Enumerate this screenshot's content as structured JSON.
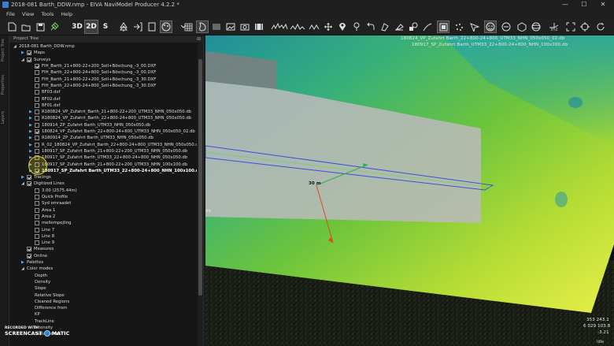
{
  "window": {
    "title": "2018-081 Barth_DDW.nmp - EIVA NaviModel Producer 4.2.2 *",
    "minimize": "—",
    "maximize": "☐",
    "close": "✕"
  },
  "menu": [
    "File",
    "View",
    "Tools",
    "Help"
  ],
  "toolbar": {
    "btn_3d": "3D",
    "btn_2d": "2D",
    "btn_s": "S",
    "xyz": "XYZ"
  },
  "sidetabs": [
    "Project Tree",
    "Properties",
    "Layers"
  ],
  "panel": {
    "title": "Project Tree",
    "pin": "⊞"
  },
  "tree": [
    {
      "label": "2018-081 Barth_DDW.nmp",
      "indent": 0,
      "expander": "open",
      "check": "none"
    },
    {
      "label": "Maps",
      "indent": 1,
      "expander": "closed",
      "check": "on"
    },
    {
      "label": "Surveys",
      "indent": 1,
      "expander": "open",
      "check": "on"
    },
    {
      "label": "FIH_Barth_21+800-22+200_Soll+Böschung_-3_00.DXF",
      "indent": 2,
      "expander": "none",
      "check": "on"
    },
    {
      "label": "FIH_Barth_22+800-24+800_Soll+Böschung_-3_00.DXF",
      "indent": 2,
      "expander": "none",
      "check": "off"
    },
    {
      "label": "FIH_Barth_21+800-22+200_Soll+Böschung_-3_30.DXF",
      "indent": 2,
      "expander": "none",
      "check": "off"
    },
    {
      "label": "FIH_Barth_22+800-24+800_Soll+Böschung_-3_30.DXF",
      "indent": 2,
      "expander": "none",
      "check": "off"
    },
    {
      "label": "BF03.dxf",
      "indent": 2,
      "expander": "none",
      "check": "off"
    },
    {
      "label": "BF02.dxf",
      "indent": 2,
      "expander": "none",
      "check": "off"
    },
    {
      "label": "BF01.dxf",
      "indent": 2,
      "expander": "none",
      "check": "off"
    },
    {
      "label": "R180824_VP_Zufahrt_Barth_21+800-22+200_UTM33_NHN_050x050.db",
      "indent": 2,
      "expander": "closed",
      "check": "off"
    },
    {
      "label": "R180824_VP_Zufahrt_Barth_22+800-24+800_UTM33_NHN_050x050.db",
      "indent": 2,
      "expander": "closed",
      "check": "off"
    },
    {
      "label": "180914_ZP_Zufahrt Barth_UTM33_NHN_050x050.db",
      "indent": 2,
      "expander": "closed",
      "check": "off"
    },
    {
      "label": "180824_VP_Zufahrt Barth_22+800-24+800_UTM33_NHN_050x050_02.db",
      "indent": 2,
      "expander": "closed",
      "check": "on"
    },
    {
      "label": "R180914_ZP_Zufahrt Barth_UTM33_NHN_050x050.db",
      "indent": 2,
      "expander": "closed",
      "check": "off"
    },
    {
      "label": "R_02_180824_VP_Zufahrt_Barth_22+800-24+800_UTM33_NHN_050x050.dt",
      "indent": 2,
      "expander": "closed",
      "check": "off"
    },
    {
      "label": "180917_SP_Zufahrt Barth_21+800-22+200_UTM33_NHN_050x050.db",
      "indent": 2,
      "expander": "closed",
      "check": "off"
    },
    {
      "label": "180917_SP_Zufahrt Barth_UTM33_22+800-24+800_NHN_050x050.db",
      "indent": 2,
      "expander": "closed",
      "check": "off"
    },
    {
      "label": "180917_SP_Zufahrt Barth_21+800-22+200_UTM33_NHN_100x100.db",
      "indent": 2,
      "expander": "closed",
      "check": "off"
    },
    {
      "label": "180917_SP_Zufahrt Barth_UTM33_22+800-24+800_NHN_100x100.db",
      "indent": 2,
      "expander": "closed",
      "check": "on",
      "bold": true
    },
    {
      "label": "Tracings",
      "indent": 1,
      "expander": "closed",
      "check": "on"
    },
    {
      "label": "Digitized Lines",
      "indent": 1,
      "expander": "open",
      "check": "on"
    },
    {
      "label": "3.00 (2575.44m)",
      "indent": 2,
      "expander": "none",
      "check": "off"
    },
    {
      "label": "Quick Profile",
      "indent": 2,
      "expander": "none",
      "check": "off"
    },
    {
      "label": "Syd omraadet",
      "indent": 2,
      "expander": "none",
      "check": "off"
    },
    {
      "label": "Area 1",
      "indent": 2,
      "expander": "none",
      "check": "off"
    },
    {
      "label": "Area 2",
      "indent": 2,
      "expander": "none",
      "check": "off"
    },
    {
      "label": "mellempejling",
      "indent": 2,
      "expander": "none",
      "check": "off"
    },
    {
      "label": "Line 7",
      "indent": 2,
      "expander": "none",
      "check": "off"
    },
    {
      "label": "Line 8",
      "indent": 2,
      "expander": "none",
      "check": "off"
    },
    {
      "label": "Line 9",
      "indent": 2,
      "expander": "none",
      "check": "off"
    },
    {
      "label": "Measures",
      "indent": 1,
      "expander": "none",
      "check": "on"
    },
    {
      "label": "Online",
      "indent": 1,
      "expander": "none",
      "check": "on"
    },
    {
      "label": "Palettes",
      "indent": 1,
      "expander": "closed",
      "check": "none"
    },
    {
      "label": "Color modes",
      "indent": 1,
      "expander": "open",
      "check": "none"
    },
    {
      "label": "Depth",
      "indent": 2,
      "expander": "none",
      "check": "none"
    },
    {
      "label": "Density",
      "indent": 2,
      "expander": "none",
      "check": "none"
    },
    {
      "label": "Slope",
      "indent": 2,
      "expander": "none",
      "check": "none"
    },
    {
      "label": "Relative Slope",
      "indent": 2,
      "expander": "none",
      "check": "none"
    },
    {
      "label": "Cleaned Regions",
      "indent": 2,
      "expander": "none",
      "check": "none"
    },
    {
      "label": "Difference from",
      "indent": 2,
      "expander": "none",
      "check": "none"
    },
    {
      "label": "KP",
      "indent": 2,
      "expander": "none",
      "check": "none"
    },
    {
      "label": "TrackLine",
      "indent": 2,
      "expander": "none",
      "check": "none"
    },
    {
      "label": "Intensity",
      "indent": 2,
      "expander": "none",
      "check": "none"
    },
    {
      "label": "Transponder",
      "indent": 2,
      "expander": "none",
      "check": "none"
    }
  ],
  "viewport": {
    "label_line1": "180824_VP_Zufahrt Barth_22+800-24+800_UTM33_NHN_050x050_02.db",
    "label_line2": "180917_SP_Zufahrt Barth_UTM33_22+800-24+800_NHN_100x100.db",
    "measure": "30 m",
    "db_label": "db",
    "coord_line1": "353 243.1",
    "coord_line2": "6 029 103.8",
    "coord_line3": "-3.21"
  },
  "recorder": {
    "top": "RECORDED WITH",
    "brand_left": "SCREENCAST",
    "brand_right": "MATIC"
  },
  "status": {
    "idle": "Idle"
  },
  "colors": {
    "accent": "#3a7bd5",
    "terrain_high": "#f0f048",
    "terrain_low": "#2a9a9a"
  }
}
